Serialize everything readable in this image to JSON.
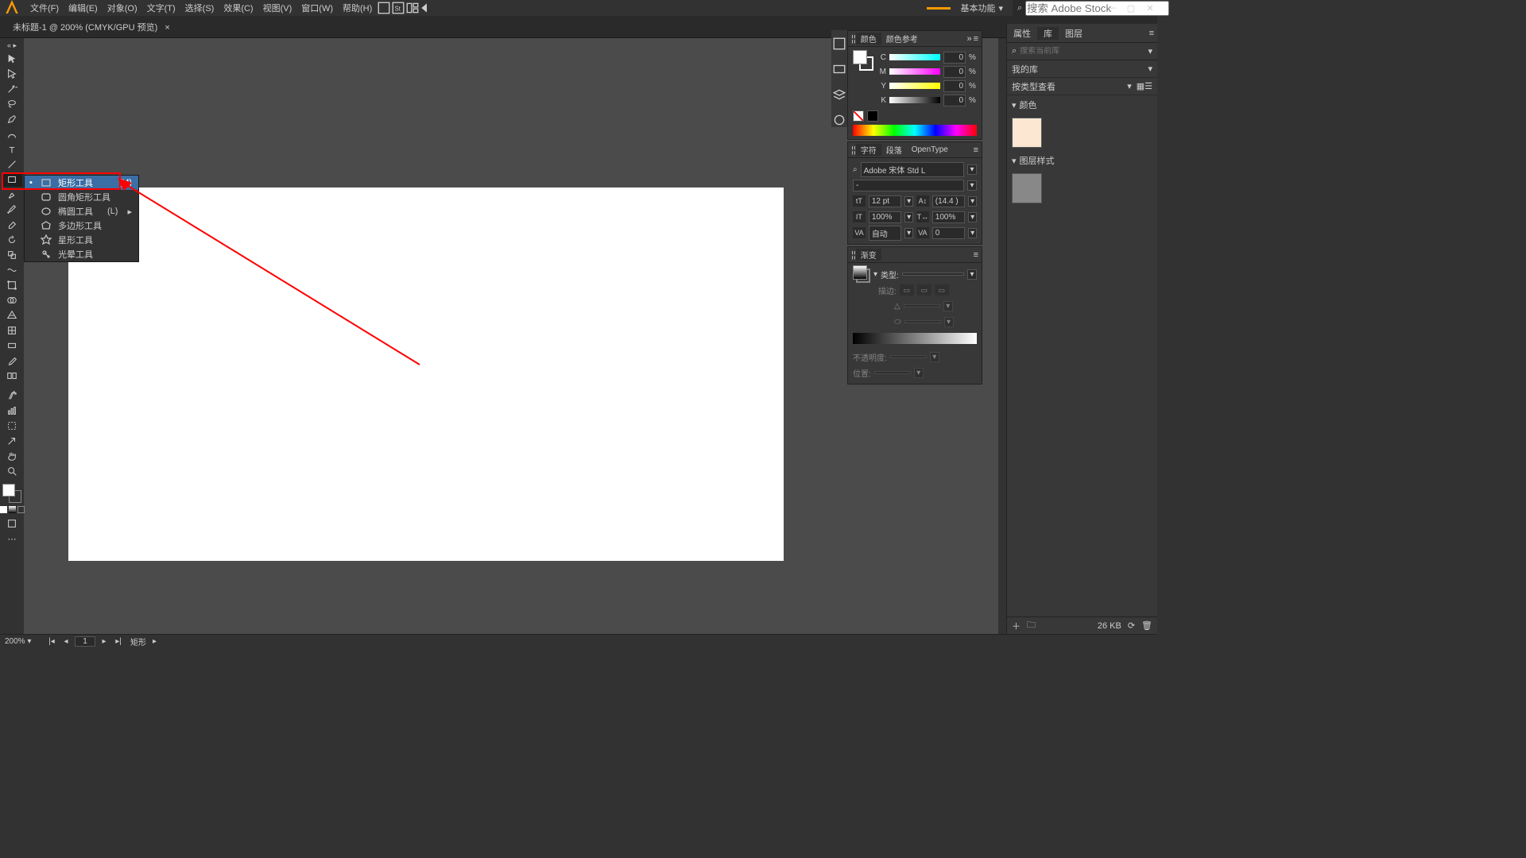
{
  "menubar": {
    "items": [
      "文件(F)",
      "编辑(E)",
      "对象(O)",
      "文字(T)",
      "选择(S)",
      "效果(C)",
      "视图(V)",
      "窗口(W)",
      "帮助(H)"
    ]
  },
  "topright": {
    "workspace": "基本功能",
    "search_placeholder": "搜索 Adobe Stock"
  },
  "doc_tab": {
    "title": "未标题-1 @ 200% (CMYK/GPU 预览)"
  },
  "flyout": {
    "items": [
      {
        "label": "矩形工具",
        "shortcut": "(M)"
      },
      {
        "label": "圆角矩形工具",
        "shortcut": ""
      },
      {
        "label": "椭圆工具",
        "shortcut": "(L)"
      },
      {
        "label": "多边形工具",
        "shortcut": ""
      },
      {
        "label": "星形工具",
        "shortcut": ""
      },
      {
        "label": "光晕工具",
        "shortcut": ""
      }
    ]
  },
  "panels": {
    "color": {
      "tab1": "颜色",
      "tab2": "颜色参考",
      "c": "C",
      "m": "M",
      "y": "Y",
      "k": "K",
      "zero": "0",
      "pct": "%"
    },
    "char": {
      "tab1": "字符",
      "tab2": "段落",
      "tab3": "OpenType",
      "font": "Adobe 宋体 Std L",
      "weight": "-",
      "size": "12 pt",
      "leading": "(14.4 )",
      "h100": "100%",
      "w100": "100%",
      "kerning": "自动",
      "tracking": "0"
    },
    "grad": {
      "tab": "渐变",
      "type_lbl": "类型:",
      "stroke_lbl": "描边:",
      "opacity_lbl": "不透明度:",
      "pos_lbl": "位置:"
    },
    "lib": {
      "tab1": "属性",
      "tab2": "库",
      "tab3": "图层",
      "search": "搜索当前库",
      "mylib": "我的库",
      "view": "按类型查看",
      "color_sec": "颜色",
      "style_sec": "图层样式"
    }
  },
  "status": {
    "zoom": "200%",
    "page": "1",
    "tool": "矩形",
    "size": "26 KB"
  }
}
